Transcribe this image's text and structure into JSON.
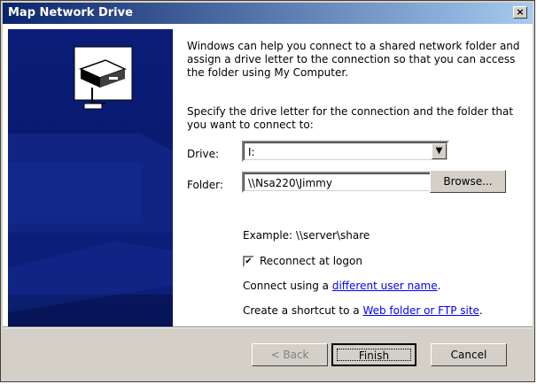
{
  "window": {
    "title": "Map Network Drive",
    "close_label": "×"
  },
  "intro": "Windows can help you connect to a shared network folder and assign a drive letter to the connection so that you can access the folder using My Computer.",
  "specify": "Specify the drive letter for the connection and the folder that you want to connect to:",
  "drive": {
    "label": "Drive:",
    "value": "I:"
  },
  "folder": {
    "label": "Folder:",
    "value": "\\\\Nsa220\\Jimmy"
  },
  "browse_label": "Browse...",
  "example": "Example: \\\\server\\share",
  "reconnect": {
    "label": "Reconnect at logon",
    "checked": true
  },
  "connect": {
    "prefix": "Connect using a ",
    "link": "different user name",
    "suffix": "."
  },
  "shortcut": {
    "prefix": "Create a shortcut to a ",
    "link": "Web folder or FTP site",
    "suffix": "."
  },
  "buttons": {
    "back": "< Back",
    "finish": "Finish",
    "cancel": "Cancel"
  }
}
